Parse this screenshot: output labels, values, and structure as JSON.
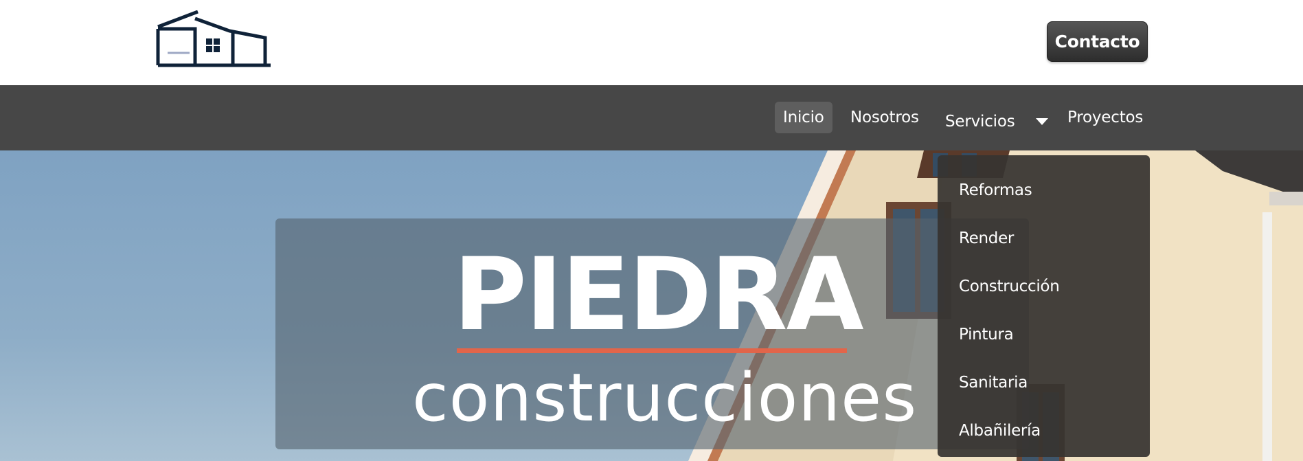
{
  "header": {
    "logo_icon": "house-logo-icon",
    "contact_label": "Contacto"
  },
  "nav": {
    "items": [
      {
        "label": "Inicio",
        "active": true
      },
      {
        "label": "Nosotros",
        "active": false
      },
      {
        "label": "Servicios",
        "active": false
      },
      {
        "label": "Proyectos",
        "active": false
      }
    ],
    "caret_icon": "chevron-down-icon"
  },
  "hero": {
    "title": "PIEDRA",
    "subtitle": "construcciones"
  },
  "dropdown": {
    "items": [
      "Reformas",
      "Render",
      "Construcción",
      "Pintura",
      "Sanitaria",
      "Albañilería"
    ]
  },
  "colors": {
    "navbar": "#474747",
    "accent_underline": "#e2654a",
    "logo": "#0f2238"
  }
}
